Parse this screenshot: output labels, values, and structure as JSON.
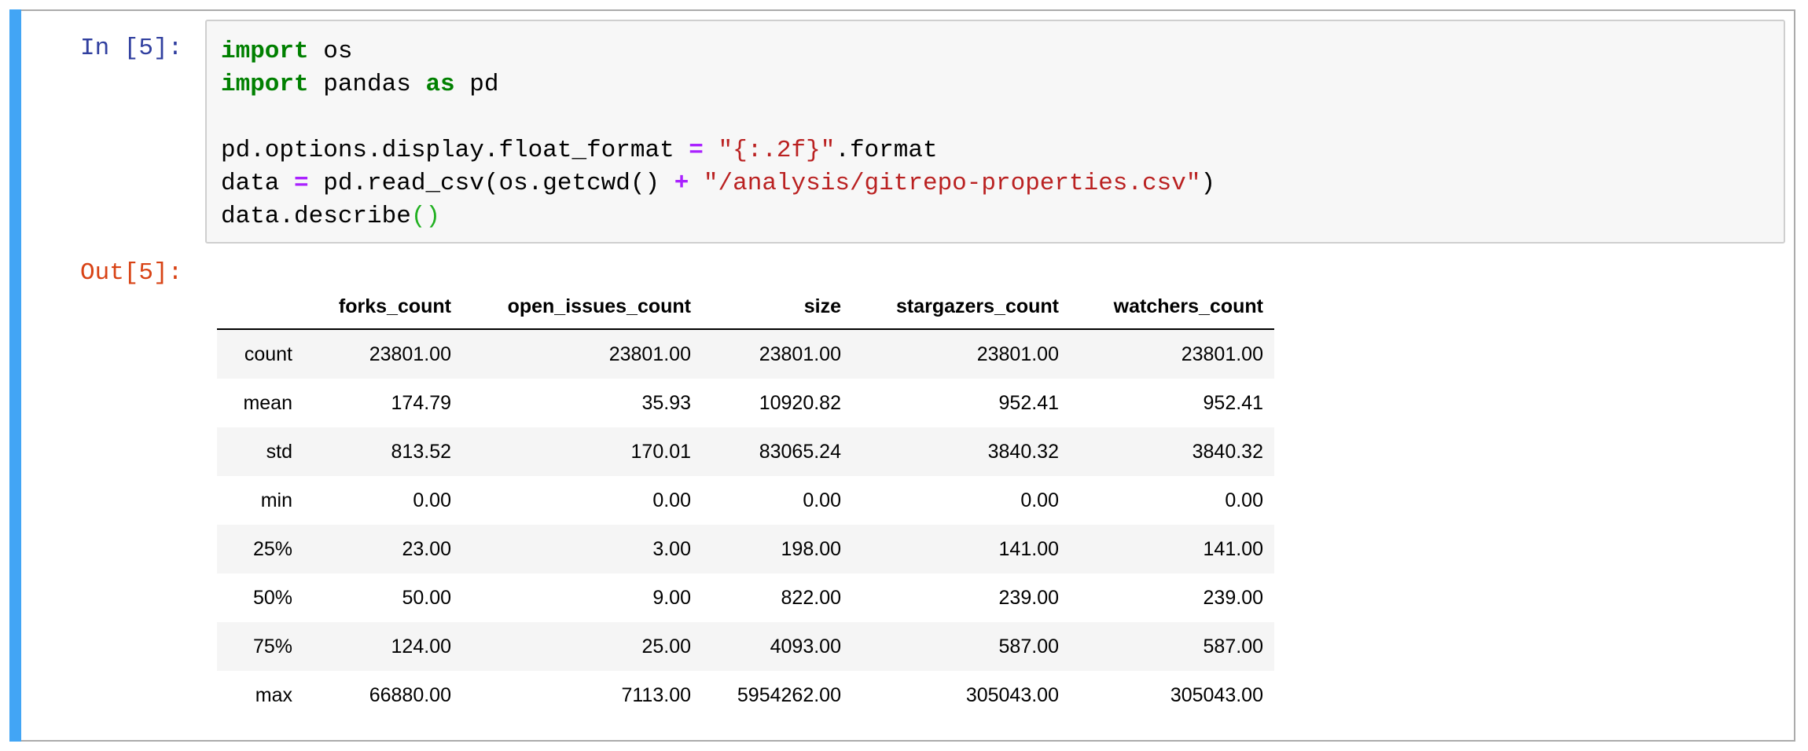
{
  "cell": {
    "in_prompt": "In [5]:",
    "out_prompt": "Out[5]:",
    "accent_color": "#42a5f5",
    "code_lines": [
      [
        {
          "t": "import",
          "c": "kw"
        },
        {
          "t": " os",
          "c": ""
        }
      ],
      [
        {
          "t": "import",
          "c": "kw"
        },
        {
          "t": " pandas ",
          "c": ""
        },
        {
          "t": "as",
          "c": "kw"
        },
        {
          "t": " pd",
          "c": ""
        }
      ],
      [],
      [
        {
          "t": "pd.options.display.float_format ",
          "c": ""
        },
        {
          "t": "=",
          "c": "op"
        },
        {
          "t": " ",
          "c": ""
        },
        {
          "t": "\"{:.2f}\"",
          "c": "str"
        },
        {
          "t": ".format",
          "c": ""
        }
      ],
      [
        {
          "t": "data ",
          "c": ""
        },
        {
          "t": "=",
          "c": "op"
        },
        {
          "t": " pd.read_csv(os.getcwd() ",
          "c": ""
        },
        {
          "t": "+",
          "c": "op"
        },
        {
          "t": " ",
          "c": ""
        },
        {
          "t": "\"/analysis/gitrepo-properties.csv\"",
          "c": "str"
        },
        {
          "t": ")",
          "c": ""
        }
      ],
      [
        {
          "t": "data.describe",
          "c": ""
        },
        {
          "t": "()",
          "c": "paren"
        }
      ]
    ]
  },
  "table": {
    "columns": [
      "",
      "forks_count",
      "open_issues_count",
      "size",
      "stargazers_count",
      "watchers_count"
    ],
    "rows": [
      [
        "count",
        "23801.00",
        "23801.00",
        "23801.00",
        "23801.00",
        "23801.00"
      ],
      [
        "mean",
        "174.79",
        "35.93",
        "10920.82",
        "952.41",
        "952.41"
      ],
      [
        "std",
        "813.52",
        "170.01",
        "83065.24",
        "3840.32",
        "3840.32"
      ],
      [
        "min",
        "0.00",
        "0.00",
        "0.00",
        "0.00",
        "0.00"
      ],
      [
        "25%",
        "23.00",
        "3.00",
        "198.00",
        "141.00",
        "141.00"
      ],
      [
        "50%",
        "50.00",
        "9.00",
        "822.00",
        "239.00",
        "239.00"
      ],
      [
        "75%",
        "124.00",
        "25.00",
        "4093.00",
        "587.00",
        "587.00"
      ],
      [
        "max",
        "66880.00",
        "7113.00",
        "5954262.00",
        "305043.00",
        "305043.00"
      ]
    ]
  }
}
